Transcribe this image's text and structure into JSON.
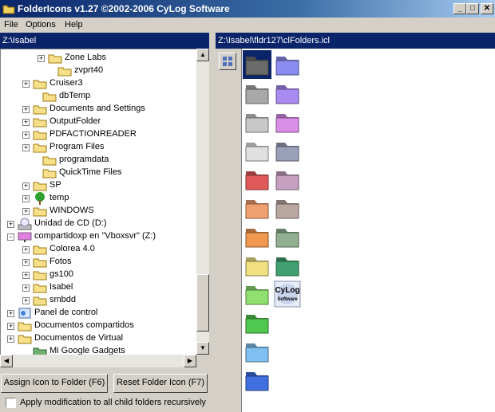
{
  "window": {
    "title": "FolderIcons v1.27 ©2002-2006 CyLog Software",
    "minimize": "_",
    "maximize": "□",
    "close": "✕"
  },
  "menu": [
    "File",
    "Options",
    "Help"
  ],
  "left_path": "Z:\\Isabel",
  "right_path": "Z:\\Isabel\\fldr127\\clFolders.icl",
  "tree": [
    {
      "label": "Zone Labs",
      "icon": "folder-icon",
      "expander": "+"
    },
    {
      "label": "zvprt40",
      "icon": "folder-icon",
      "expander": ""
    },
    {
      "label": "Cruiser3",
      "icon": "folder-icon",
      "expander": "+"
    },
    {
      "label": "dbTemp",
      "icon": "folder-icon",
      "expander": ""
    },
    {
      "label": "Documents and Settings",
      "icon": "folder-icon",
      "expander": "+"
    },
    {
      "label": "OutputFolder",
      "icon": "folder-icon",
      "expander": "+"
    },
    {
      "label": "PDFACTIONREADER",
      "icon": "folder-icon",
      "expander": "+"
    },
    {
      "label": "Program Files",
      "icon": "folder-icon",
      "expander": "+"
    },
    {
      "label": "programdata",
      "icon": "folder-icon",
      "expander": ""
    },
    {
      "label": "QuickTime Files",
      "icon": "folder-icon",
      "expander": ""
    },
    {
      "label": "SP",
      "icon": "folder-icon",
      "expander": "+"
    },
    {
      "label": "temp",
      "icon": "tree-icon",
      "expander": "+"
    },
    {
      "label": "WINDOWS",
      "icon": "folder-icon",
      "expander": "+"
    },
    {
      "label": "Unidad de CD (D:)",
      "icon": "cd-drive-icon",
      "expander": "+"
    },
    {
      "label": "compartidoxp en \"Vboxsvr\" (Z:)",
      "icon": "network-drive-icon",
      "expander": "−"
    },
    {
      "label": "Colorea 4.0",
      "icon": "folder-icon",
      "expander": "+"
    },
    {
      "label": "Fotos",
      "icon": "folder-icon",
      "expander": "+"
    },
    {
      "label": "gs100",
      "icon": "folder-icon",
      "expander": "+"
    },
    {
      "label": "Isabel",
      "icon": "folder-icon",
      "expander": "+"
    },
    {
      "label": "smbdd",
      "icon": "folder-icon",
      "expander": "+"
    },
    {
      "label": "Panel de control",
      "icon": "control-panel-icon",
      "expander": "+"
    },
    {
      "label": "Documentos compartidos",
      "icon": "folder-icon",
      "expander": "+"
    },
    {
      "label": "Documentos de Virtual",
      "icon": "folder-icon",
      "expander": "+"
    },
    {
      "label": "Mi Google Gadgets",
      "icon": "gadget-folder-icon",
      "expander": ""
    }
  ],
  "buttons": {
    "assign": "Assign Icon to Folder (F6)",
    "reset": "Reset Folder Icon (F7)"
  },
  "checkbox": {
    "label": "Apply modification to all child folders recursively",
    "checked": false
  },
  "icon_colors": [
    [
      "#6b6b6b",
      "#8a8cf0"
    ],
    [
      "#a8a8a8",
      "#a98af0"
    ],
    [
      "#c8c8c8",
      "#d98ee8"
    ],
    [
      "#e0e0e0",
      "#9aa0b8"
    ],
    [
      "#e05a5a",
      "#c6a0c0"
    ],
    [
      "#f0a070",
      "#b8a8a0"
    ],
    [
      "#f09850",
      "#90b090"
    ],
    [
      "#f0e080",
      "#40a070"
    ],
    [
      "#90e070",
      "logo"
    ],
    [
      "#50c850",
      ""
    ],
    [
      "#80c0f0",
      ""
    ],
    [
      "#4070e0",
      ""
    ]
  ],
  "logo": {
    "line1": "CyLog",
    "line2": "Software"
  }
}
